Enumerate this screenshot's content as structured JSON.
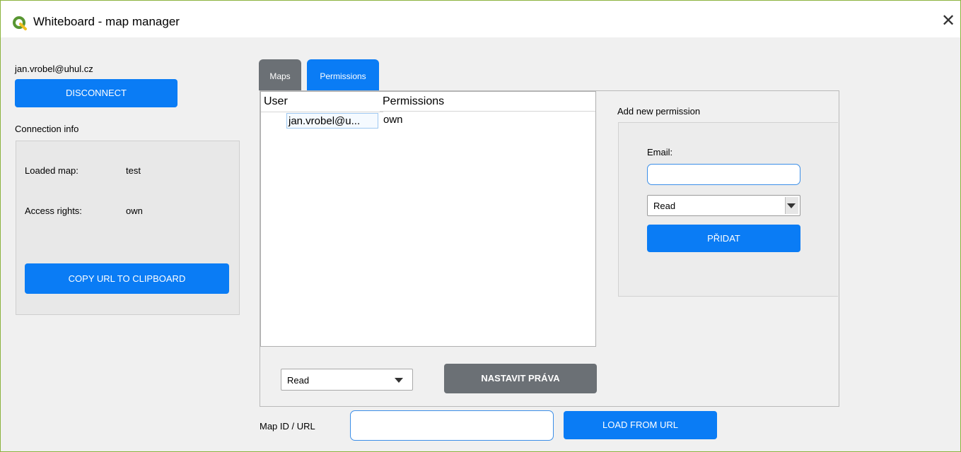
{
  "window": {
    "title": "Whiteboard - map manager"
  },
  "connection": {
    "user_email": "jan.vrobel@uhul.cz",
    "disconnect_label": "DISCONNECT",
    "section_title": "Connection info",
    "loaded_map_label": "Loaded map:",
    "loaded_map_value": "test",
    "access_rights_label": "Access rights:",
    "access_rights_value": "own",
    "copy_url_label": "COPY URL TO CLIPBOARD"
  },
  "tabs": [
    {
      "label": "Maps",
      "active": false
    },
    {
      "label": "Permissions",
      "active": true
    }
  ],
  "permissions_table": {
    "columns": [
      "User",
      "Permissions"
    ],
    "rows": [
      {
        "user": "jan.vrobel@u...",
        "permission": "own"
      }
    ]
  },
  "bottom_controls": {
    "permission_select": "Read",
    "set_rights_label": "NASTAVIT PRÁVA"
  },
  "add_permission": {
    "title": "Add new permission",
    "email_label": "Email:",
    "email_value": "",
    "permission_select": "Read",
    "add_label": "PŘIDAT"
  },
  "map_url": {
    "label": "Map ID / URL",
    "value": "",
    "load_label": "LOAD FROM URL"
  },
  "colors": {
    "accent": "#0a7cf5",
    "window_border": "#8cb33f",
    "disabled_button": "#6b7075"
  },
  "icons": {
    "app": "qgis-logo-icon",
    "close": "close-icon",
    "dropdown": "chevron-down-icon"
  }
}
